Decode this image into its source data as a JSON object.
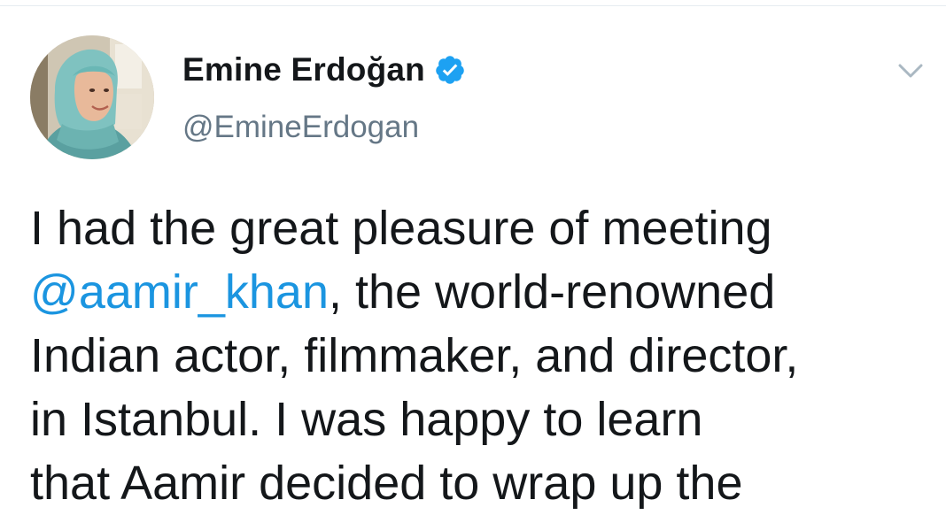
{
  "user": {
    "display_name": "Emine Erdoğan",
    "handle": "@EmineErdogan",
    "verified": true
  },
  "icons": {
    "verified": "verified-badge-icon",
    "menu": "chevron-down-icon"
  },
  "tweet": {
    "lines": [
      {
        "text": "I had the great pleasure of meeting"
      },
      {
        "mention": "@aamir_khan",
        "text": ", the world-renowned"
      },
      {
        "text": "Indian actor, filmmaker, and director,"
      },
      {
        "text": "in Istanbul. I was happy to learn"
      },
      {
        "text": "that Aamir decided to wrap up the"
      }
    ]
  },
  "colors": {
    "text": "#14171a",
    "secondary": "#657786",
    "link": "#1b95e0",
    "verified": "#1da1f2",
    "divider": "#e6ecf0"
  }
}
